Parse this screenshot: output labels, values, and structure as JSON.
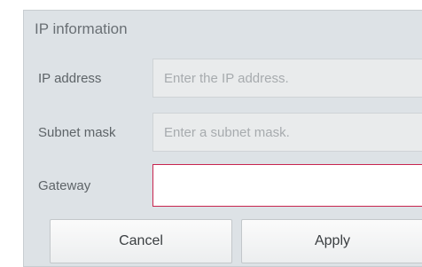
{
  "dialog": {
    "title": "IP information"
  },
  "fields": {
    "ip_address": {
      "label": "IP address",
      "placeholder": "Enter the IP address.",
      "value": ""
    },
    "subnet_mask": {
      "label": "Subnet mask",
      "placeholder": "Enter a subnet mask.",
      "value": ""
    },
    "gateway": {
      "label": "Gateway",
      "placeholder": "",
      "value": ""
    }
  },
  "buttons": {
    "cancel_label": "Cancel",
    "apply_label": "Apply"
  },
  "colors": {
    "dialog_bg": "#dde2e6",
    "focus_border": "#c8254f"
  }
}
